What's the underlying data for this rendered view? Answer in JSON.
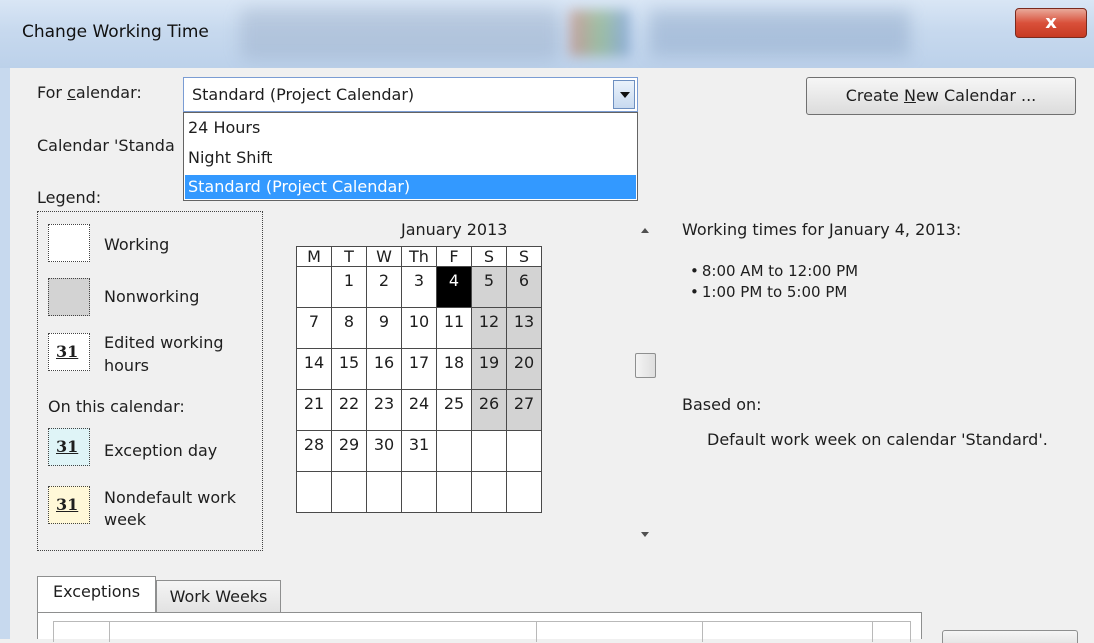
{
  "window": {
    "title": "Change Working Time",
    "close_glyph": "x"
  },
  "calendar_select": {
    "label_prefix": "For ",
    "label_underlined": "c",
    "label_suffix": "alendar:",
    "value": "Standard (Project Calendar)",
    "options": [
      "24 Hours",
      "Night Shift",
      "Standard (Project Calendar)"
    ],
    "highlighted_option": "Standard (Project Calendar)"
  },
  "create_button": {
    "prefix": "Create ",
    "underlined": "N",
    "suffix": "ew Calendar ..."
  },
  "calendar_note": "Calendar 'Standa",
  "legend": {
    "title": "Legend:",
    "working": "Working",
    "nonworking": "Nonworking",
    "edited_line1": "Edited working",
    "edited_line2": "hours",
    "swatch_number": "31",
    "on_this_calendar": "On this calendar:",
    "exception_day": "Exception day",
    "nondefault_line1": "Nondefault work",
    "nondefault_line2": "week"
  },
  "month": {
    "title": "January 2013",
    "day_headers": [
      "M",
      "T",
      "W",
      "Th",
      "F",
      "S",
      "S"
    ],
    "weeks": [
      [
        "",
        "1",
        "2",
        "3",
        "4",
        "5",
        "6"
      ],
      [
        "7",
        "8",
        "9",
        "10",
        "11",
        "12",
        "13"
      ],
      [
        "14",
        "15",
        "16",
        "17",
        "18",
        "19",
        "20"
      ],
      [
        "21",
        "22",
        "23",
        "24",
        "25",
        "26",
        "27"
      ],
      [
        "28",
        "29",
        "30",
        "31",
        "",
        "",
        ""
      ],
      [
        "",
        "",
        "",
        "",
        "",
        "",
        ""
      ]
    ],
    "selected_day": "4",
    "nonworking_columns": [
      "S",
      "S"
    ]
  },
  "working_times": {
    "heading": "Working times for January 4, 2013:",
    "ranges": [
      "8:00 AM to 12:00 PM",
      "1:00 PM to 5:00 PM"
    ],
    "based_on_label": "Based on:",
    "based_on_text": "Default work week on calendar 'Standard'."
  },
  "tabs": [
    "Exceptions",
    "Work Weeks"
  ],
  "colors": {
    "nonworking": "#d3d3d3",
    "selected_day": "#000000",
    "dropdown_highlight": "#3399ff",
    "exception_swatch": "#dff4f7",
    "nondefault_swatch": "#fff8d8",
    "close_button": "#c73a22"
  }
}
